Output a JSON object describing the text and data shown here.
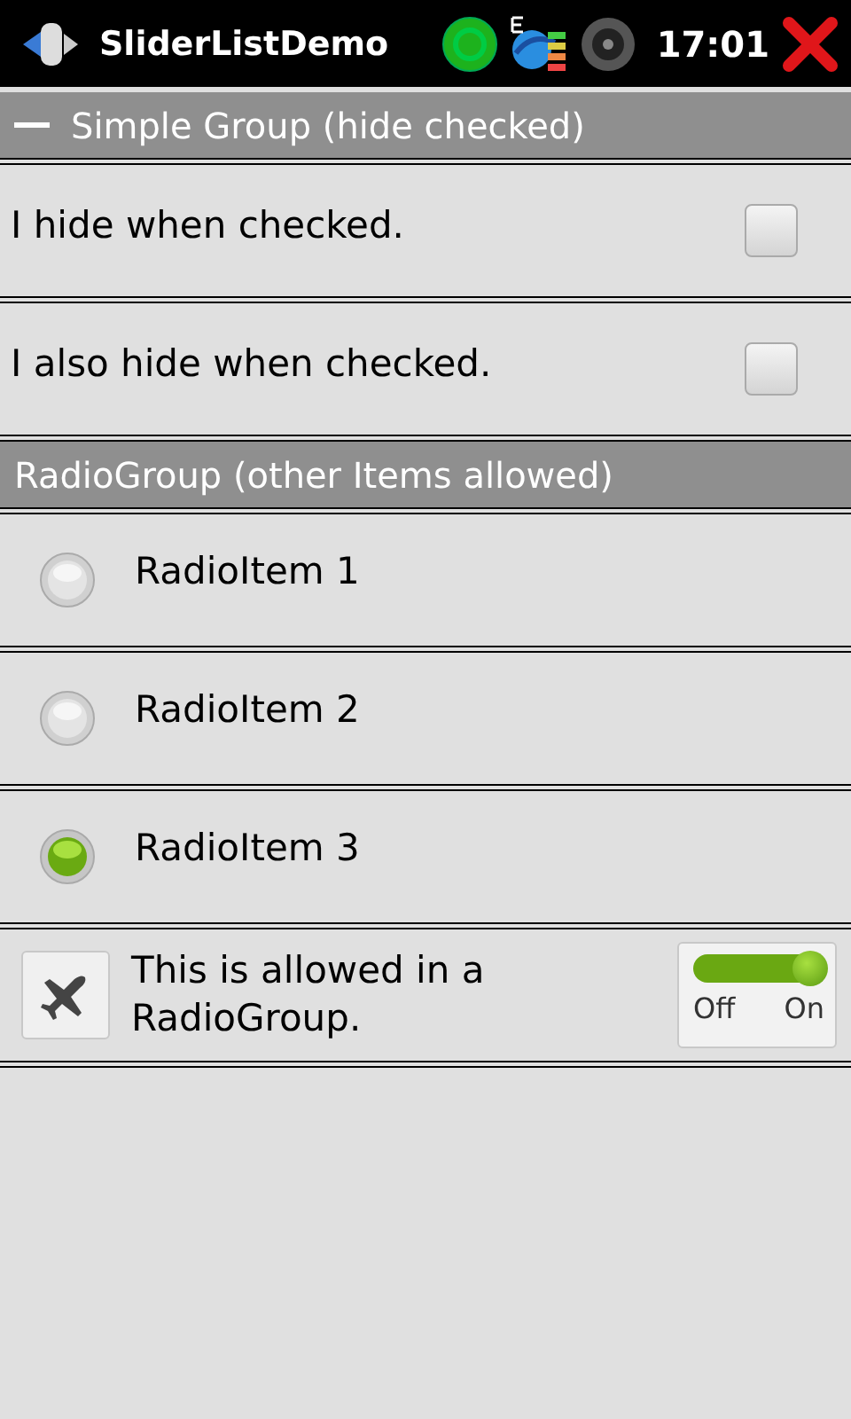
{
  "status_bar": {
    "title": "SliderListDemo",
    "time": "17:01"
  },
  "groups": [
    {
      "title": "Simple Group (hide checked)",
      "expanded": true,
      "items": [
        {
          "kind": "checkbox",
          "label": "I hide when checked.",
          "checked": false
        },
        {
          "kind": "checkbox",
          "label": "I also hide when checked.",
          "checked": false
        }
      ]
    },
    {
      "title": "RadioGroup (other Items allowed)",
      "items": [
        {
          "kind": "radio",
          "label": "RadioItem 1",
          "selected": false
        },
        {
          "kind": "radio",
          "label": "RadioItem 2",
          "selected": false
        },
        {
          "kind": "radio",
          "label": "RadioItem 3",
          "selected": true
        },
        {
          "kind": "toggle",
          "label": "This is allowed in a RadioGroup.",
          "on": true,
          "off_label": "Off",
          "on_label": "On"
        }
      ]
    }
  ]
}
